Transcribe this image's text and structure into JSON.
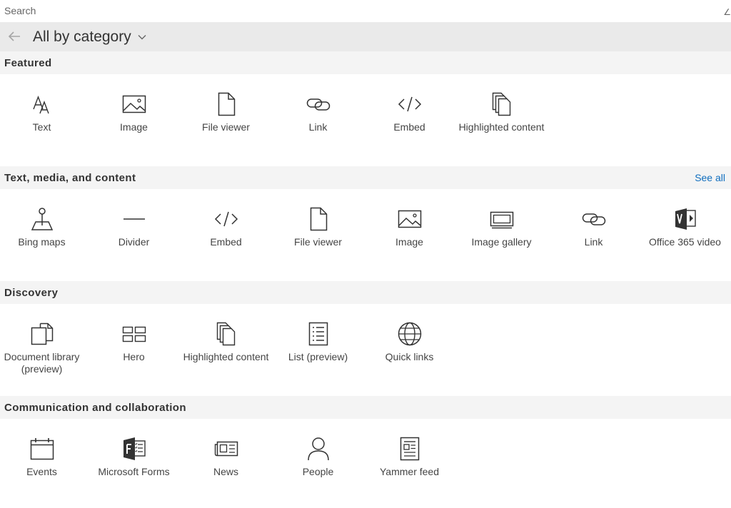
{
  "search": {
    "placeholder": "Search"
  },
  "nav": {
    "category_label": "All by category"
  },
  "sections": [
    {
      "title": "Featured",
      "items": [
        {
          "label": "Text",
          "icon": "text-icon"
        },
        {
          "label": "Image",
          "icon": "image-icon"
        },
        {
          "label": "File viewer",
          "icon": "file-icon"
        },
        {
          "label": "Link",
          "icon": "link-icon"
        },
        {
          "label": "Embed",
          "icon": "embed-icon"
        },
        {
          "label": "Highlighted content",
          "icon": "highlighted-content-icon"
        }
      ]
    },
    {
      "title": "Text, media, and content",
      "see_all": "See all",
      "items": [
        {
          "label": "Bing maps",
          "icon": "map-pin-icon"
        },
        {
          "label": "Divider",
          "icon": "divider-icon"
        },
        {
          "label": "Embed",
          "icon": "embed-icon"
        },
        {
          "label": "File viewer",
          "icon": "file-icon"
        },
        {
          "label": "Image",
          "icon": "image-icon"
        },
        {
          "label": "Image gallery",
          "icon": "image-gallery-icon"
        },
        {
          "label": "Link",
          "icon": "link-icon"
        },
        {
          "label": "Office 365 video",
          "icon": "office-video-icon"
        }
      ]
    },
    {
      "title": "Discovery",
      "items": [
        {
          "label": "Document library (preview)",
          "icon": "document-library-icon"
        },
        {
          "label": "Hero",
          "icon": "hero-icon"
        },
        {
          "label": "Highlighted content",
          "icon": "highlighted-content-icon"
        },
        {
          "label": "List (preview)",
          "icon": "list-icon"
        },
        {
          "label": "Quick links",
          "icon": "globe-icon"
        }
      ]
    },
    {
      "title": "Communication and collaboration",
      "items": [
        {
          "label": "Events",
          "icon": "calendar-icon"
        },
        {
          "label": "Microsoft Forms",
          "icon": "forms-icon"
        },
        {
          "label": "News",
          "icon": "news-icon"
        },
        {
          "label": "People",
          "icon": "person-icon"
        },
        {
          "label": "Yammer feed",
          "icon": "yammer-feed-icon"
        }
      ]
    }
  ]
}
